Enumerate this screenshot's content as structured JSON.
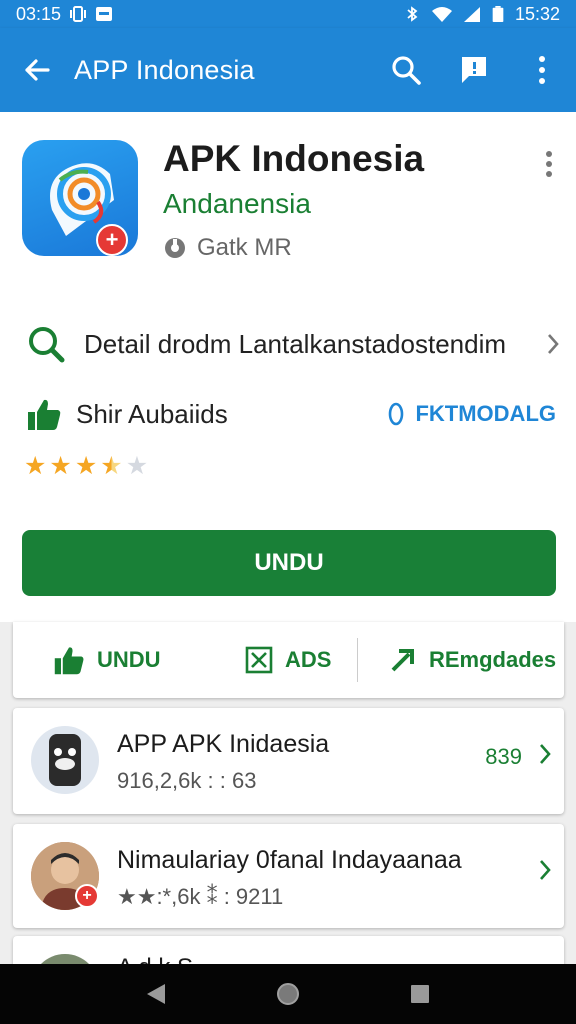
{
  "status_bar": {
    "time": "03:15",
    "clock_right": "15:32",
    "icons": [
      "vibrate-icon",
      "notification-icon",
      "bluetooth-icon",
      "wifi-icon",
      "signal-icon",
      "battery-icon"
    ]
  },
  "app_bar": {
    "title": "APP Indonesia",
    "icons": [
      "back-arrow-icon",
      "search-icon",
      "feedback-icon",
      "more-vert-icon"
    ]
  },
  "app": {
    "name": "APK Indonesia",
    "developer": "Andanensia",
    "size": "Gatk MR",
    "detail_text": "Detail drodm Lantalkanstadostendim",
    "rating_label": "Shir Aubaiids",
    "rating_action": "FKTMODALG",
    "rating": 3.5,
    "rating_max": 5,
    "install_label": "UNDU"
  },
  "actions": [
    {
      "label": "UNDU",
      "icon": "thumbs-up-icon"
    },
    {
      "label": "ADS",
      "icon": "checkbox-x-icon"
    },
    {
      "label": "REmgdades",
      "icon": "arrow-up-right-icon"
    }
  ],
  "related": [
    {
      "title": "APP APK Inidaesia",
      "subtitle": "916,2,6k : : 63",
      "count": "839"
    },
    {
      "title": "Nimaulariay 0fanal Indayaanaa",
      "subtitle": "★★:*,6k ⁑ : 9211",
      "count": ""
    },
    {
      "title": "A  d    k    S",
      "subtitle": "",
      "count": ""
    }
  ],
  "colors": {
    "primary": "#1f86d6",
    "accent_green": "#198037",
    "star": "#f5a623",
    "badge_red": "#e53935"
  }
}
